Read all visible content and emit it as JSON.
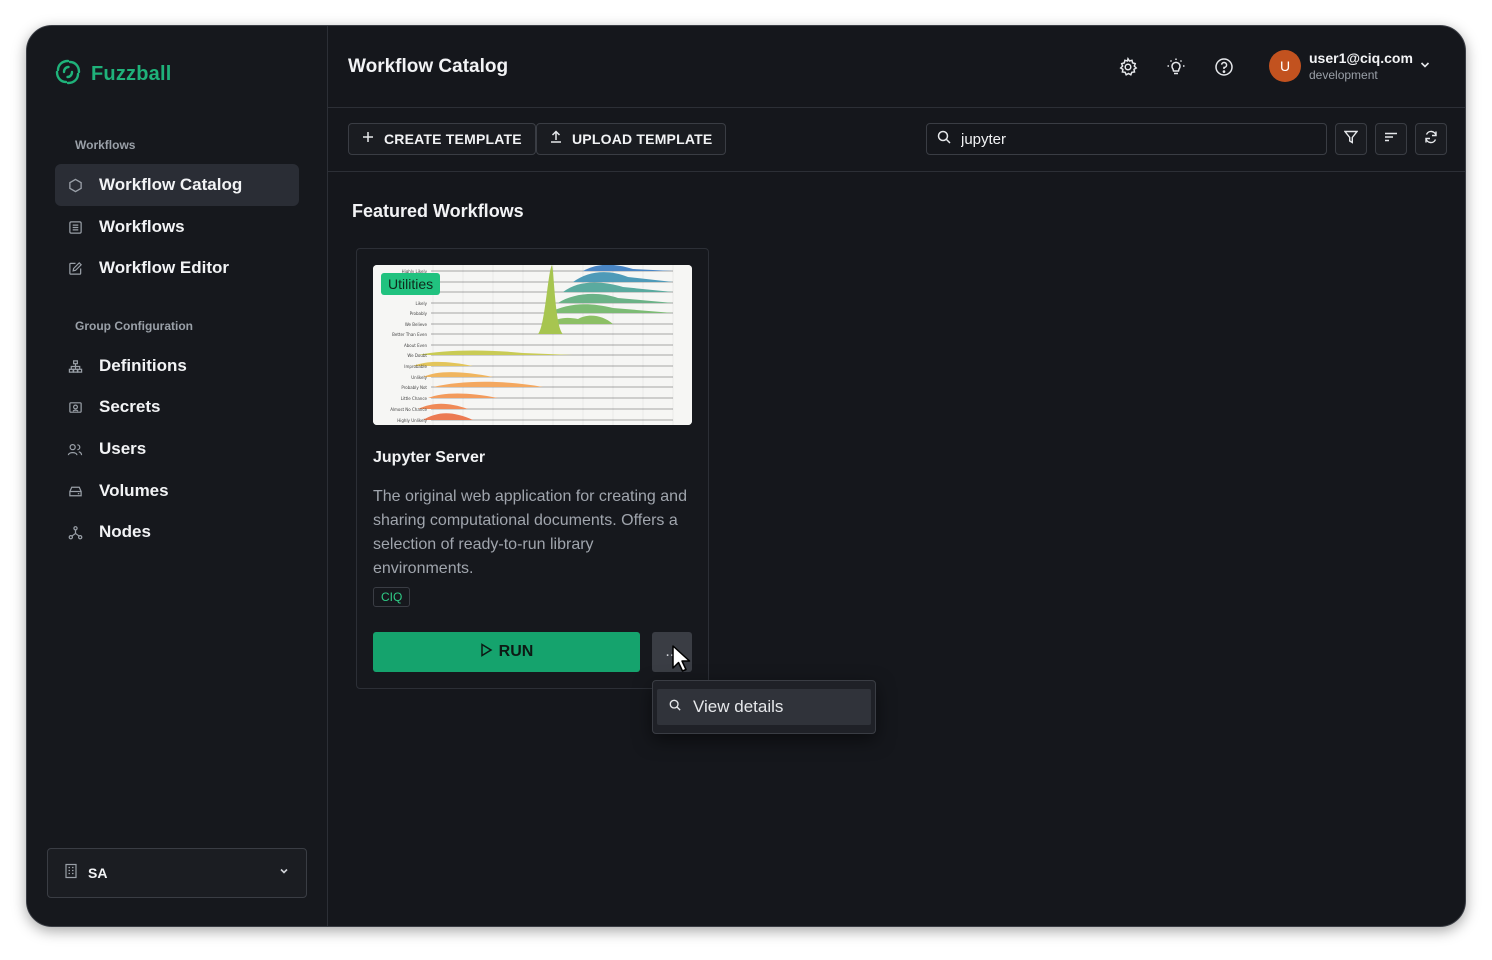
{
  "app": {
    "name": "Fuzzball"
  },
  "sidebar": {
    "sections": [
      {
        "label": "Workflows"
      },
      {
        "label": "Group Configuration"
      }
    ],
    "items": [
      {
        "label": "Workflow Catalog",
        "icon": "hexagon-icon",
        "active": true
      },
      {
        "label": "Workflows",
        "icon": "list-icon"
      },
      {
        "label": "Workflow Editor",
        "icon": "edit-icon"
      },
      {
        "label": "Definitions",
        "icon": "hierarchy-icon"
      },
      {
        "label": "Secrets",
        "icon": "secret-icon"
      },
      {
        "label": "Users",
        "icon": "users-icon"
      },
      {
        "label": "Volumes",
        "icon": "drive-icon"
      },
      {
        "label": "Nodes",
        "icon": "nodes-icon"
      }
    ],
    "org": {
      "label": "SA",
      "icon": "building-icon"
    }
  },
  "header": {
    "title": "Workflow Catalog",
    "user": {
      "initial": "U",
      "email": "user1@ciq.com",
      "environment": "development"
    }
  },
  "toolbar": {
    "create_label": "CREATE TEMPLATE",
    "upload_label": "UPLOAD TEMPLATE",
    "search_value": "jupyter"
  },
  "featured": {
    "title": "Featured Workflows",
    "card": {
      "category": "Utilities",
      "title": "Jupyter Server",
      "description": "The original web application for creating and sharing computational documents. Offers a selection of ready-to-run library environments.",
      "tag": "CIQ",
      "run_label": "RUN",
      "more_label": "..."
    }
  },
  "menu": {
    "view_details_label": "View details"
  },
  "colors": {
    "accent": "#1fb27a",
    "run": "#15a36d",
    "badge": "#21c27f",
    "avatar": "#c2521f"
  }
}
